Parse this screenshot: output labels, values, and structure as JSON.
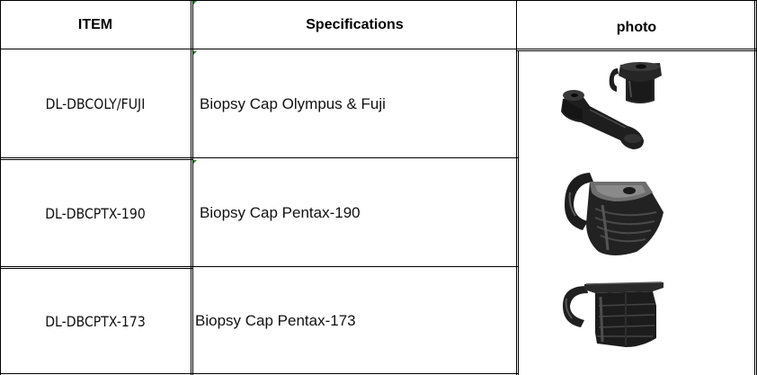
{
  "table": {
    "headers": {
      "item": "ITEM",
      "specifications": "Specifications",
      "photo": "photo"
    },
    "rows": [
      {
        "item": "DL-DBCOLY/FUJI",
        "specification": "Biopsy Cap Olympus & Fuji"
      },
      {
        "item": "DL-DBCPTX-190",
        "specification": "Biopsy Cap Pentax-190"
      },
      {
        "item": "DL-DBCPTX-173",
        "specification": "Biopsy Cap Pentax-173"
      }
    ]
  },
  "colors": {
    "border": "#000000",
    "cap_dark": "#1c1c1c",
    "cap_mid": "#3a3a3a",
    "cap_highlight": "#8a8a8a",
    "corner_mark": "#1e8a1e"
  }
}
